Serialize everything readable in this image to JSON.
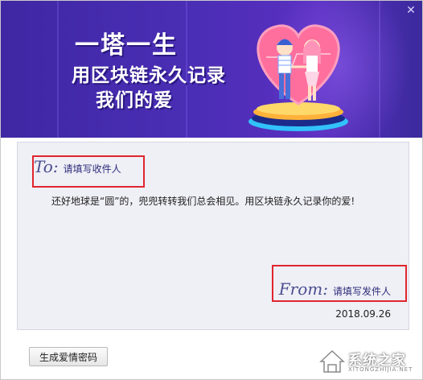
{
  "banner": {
    "line1": "一塔一生",
    "line2": "用区块链永久记录",
    "line3": "我们的爱"
  },
  "card": {
    "to_label": "To:",
    "to_placeholder": "请填写收件人",
    "message": "还好地球是“圆”的，兜兜转转我们总会相见。用区块链永久记录你的爱!",
    "from_label": "From:",
    "from_placeholder": "请填写发件人",
    "date": "2018.09.26"
  },
  "footer": {
    "generate_button": "生成爱情密码"
  },
  "watermark": {
    "name": "系统之家",
    "url": "XITONGZHIJIA.NET"
  },
  "colors": {
    "banner": "#4a2eb5",
    "card_bg": "#efeff6",
    "highlight": "#e0262e",
    "script_text": "#4a4e8f"
  },
  "icons": [
    "close-icon",
    "logo-house-icon"
  ]
}
